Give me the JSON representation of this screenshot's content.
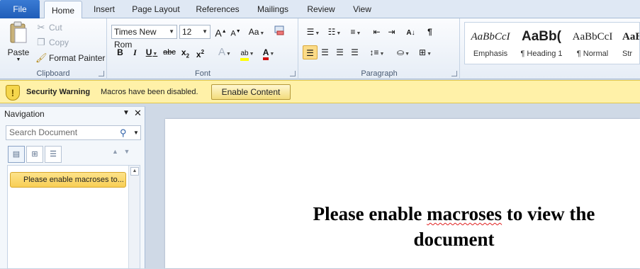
{
  "tabs": {
    "file": "File",
    "home": "Home",
    "insert": "Insert",
    "page_layout": "Page Layout",
    "references": "References",
    "mailings": "Mailings",
    "review": "Review",
    "view": "View"
  },
  "clipboard": {
    "paste": "Paste",
    "cut": "Cut",
    "copy": "Copy",
    "format_painter": "Format Painter",
    "label": "Clipboard"
  },
  "font": {
    "name": "Times New Rom",
    "size": "12",
    "label": "Font"
  },
  "paragraph": {
    "label": "Paragraph"
  },
  "styles": [
    {
      "sample": "AaBbCcI",
      "name": "Emphasis"
    },
    {
      "sample": "AaBb(",
      "name": "¶ Heading 1"
    },
    {
      "sample": "AaBbCcI",
      "name": "¶ Normal"
    },
    {
      "sample": "AaB",
      "name": "Str"
    }
  ],
  "security": {
    "title": "Security Warning",
    "message": "Macros have been disabled.",
    "button": "Enable Content"
  },
  "navigation": {
    "title": "Navigation",
    "search_placeholder": "Search Document",
    "item": "Please enable macroses to..."
  },
  "document": {
    "line1_pre": "Please enable ",
    "line1_word": "macroses",
    "line1_post": " to view the",
    "line2": "document"
  },
  "colors": {
    "file_tab": "#2a6cc8",
    "security_bar": "#fff1a8",
    "highlight": "#f8cf55"
  }
}
